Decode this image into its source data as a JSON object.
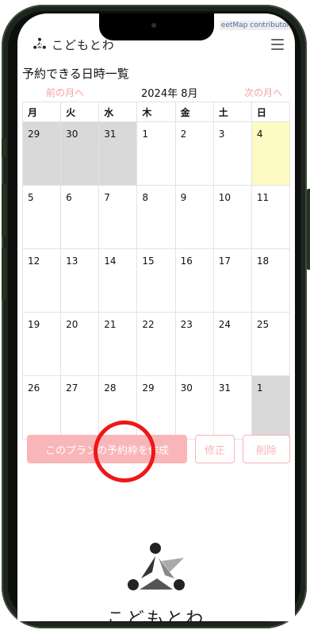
{
  "map": {
    "attribution": "eetMap contributors"
  },
  "header": {
    "logo_text": "こどもとわ",
    "menu_icon": "hamburger-icon"
  },
  "page": {
    "title": "予約できる日時一覧"
  },
  "nav": {
    "prev_label": "前の月へ",
    "current_month": "2024年 8月",
    "next_label": "次の月へ"
  },
  "calendar": {
    "weekdays": [
      "月",
      "火",
      "水",
      "木",
      "金",
      "土",
      "日"
    ],
    "weeks": [
      [
        "29",
        "30",
        "31",
        "1",
        "2",
        "3",
        "4"
      ],
      [
        "5",
        "6",
        "7",
        "8",
        "9",
        "10",
        "11"
      ],
      [
        "12",
        "13",
        "14",
        "15",
        "16",
        "17",
        "18"
      ],
      [
        "19",
        "20",
        "21",
        "22",
        "23",
        "24",
        "25"
      ],
      [
        "26",
        "27",
        "28",
        "29",
        "30",
        "31",
        "1"
      ]
    ]
  },
  "actions": {
    "create_label": "このプランの予約枠を作成",
    "edit_label": "修正",
    "delete_label": "削除"
  },
  "footer": {
    "brand_text": "こどもとわ"
  },
  "colors": {
    "accent": "#f9b6b9",
    "today": "#fdfbc3",
    "outside_month": "#d9d9d9",
    "highlight_circle": "#ef1717"
  }
}
